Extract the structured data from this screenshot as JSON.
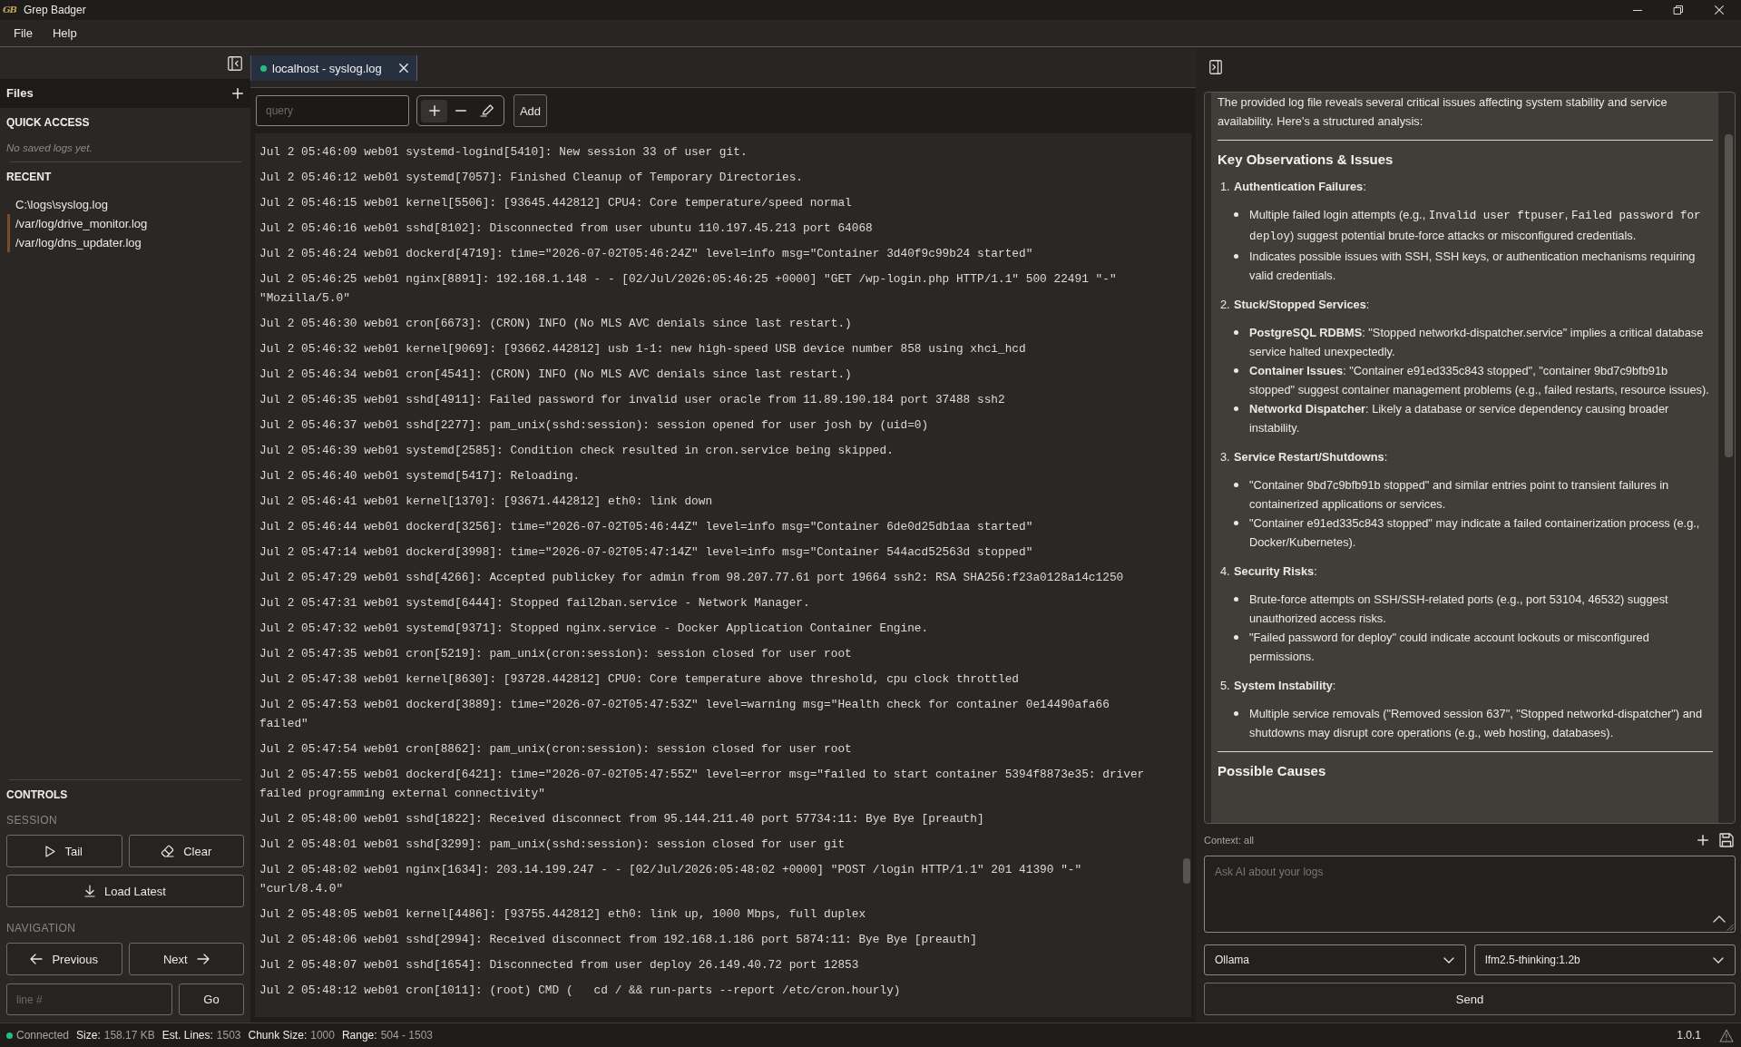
{
  "window": {
    "logo": "GB",
    "title": "Grep Badger"
  },
  "menu": [
    {
      "label": "File"
    },
    {
      "label": "Help"
    }
  ],
  "sidebar": {
    "files_title": "Files",
    "quick_access": {
      "title": "QUICK ACCESS",
      "empty_text": "No saved logs yet."
    },
    "recent": {
      "title": "RECENT",
      "items": [
        {
          "path": "C:\\logs\\syslog.log",
          "remote": false
        },
        {
          "path": "/var/log/drive_monitor.log",
          "remote": true
        },
        {
          "path": "/var/log/dns_updater.log",
          "remote": true
        }
      ]
    },
    "controls": {
      "title": "CONTROLS",
      "session": {
        "title": "SESSION",
        "buttons": [
          {
            "kind": "play",
            "label": "Tail"
          },
          {
            "kind": "eraser",
            "label": "Clear"
          },
          {
            "kind": "download",
            "label": "Load Latest"
          }
        ]
      },
      "navigation": {
        "title": "NAVIGATION",
        "buttons": [
          {
            "kind": "arrow-left",
            "label": "Previous"
          },
          {
            "kind": "arrow-right",
            "label": "Next"
          }
        ],
        "line_input": {
          "placeholder": "line #"
        },
        "go_button": "Go"
      }
    }
  },
  "tabs": [
    {
      "title": "localhost - syslog.log",
      "selected": true,
      "connected": true
    }
  ],
  "toolbar": {
    "query": {
      "placeholder": "query"
    },
    "tools": [
      {
        "kind": "plus",
        "selected": true
      },
      {
        "kind": "minus",
        "selected": false
      },
      {
        "kind": "highlighter",
        "selected": false
      }
    ],
    "add_button": "Add"
  },
  "log": {
    "lines": [
      "Jul 2 05:46:09 web01 systemd-logind[5410]: New session 33 of user git.",
      "Jul 2 05:46:12 web01 systemd[7057]: Finished Cleanup of Temporary Directories.",
      "Jul 2 05:46:15 web01 kernel[5506]: [93645.442812] CPU4: Core temperature/speed normal",
      "Jul 2 05:46:16 web01 sshd[8102]: Disconnected from user ubuntu 110.197.45.213 port 64068",
      "Jul 2 05:46:24 web01 dockerd[4719]: time=\"2026-07-02T05:46:24Z\" level=info msg=\"Container 3d40f9c99b24 started\"",
      "Jul 2 05:46:25 web01 nginx[8891]: 192.168.1.148 - - [02/Jul/2026:05:46:25 +0000] \"GET /wp-login.php HTTP/1.1\" 500 22491 \"-\" \"Mozilla/5.0\"",
      "Jul 2 05:46:30 web01 cron[6673]: (CRON) INFO (No MLS AVC denials since last restart.)",
      "Jul 2 05:46:32 web01 kernel[9069]: [93662.442812] usb 1-1: new high-speed USB device number 858 using xhci_hcd",
      "Jul 2 05:46:34 web01 cron[4541]: (CRON) INFO (No MLS AVC denials since last restart.)",
      "Jul 2 05:46:35 web01 sshd[4911]: Failed password for invalid user oracle from 11.89.190.184 port 37488 ssh2",
      "Jul 2 05:46:37 web01 sshd[2277]: pam_unix(sshd:session): session opened for user josh by (uid=0)",
      "Jul 2 05:46:39 web01 systemd[2585]: Condition check resulted in cron.service being skipped.",
      "Jul 2 05:46:40 web01 systemd[5417]: Reloading.",
      "Jul 2 05:46:41 web01 kernel[1370]: [93671.442812] eth0: link down",
      "Jul 2 05:46:44 web01 dockerd[3256]: time=\"2026-07-02T05:46:44Z\" level=info msg=\"Container 6de0d25db1aa started\"",
      "Jul 2 05:47:14 web01 dockerd[3998]: time=\"2026-07-02T05:47:14Z\" level=info msg=\"Container 544acd52563d stopped\"",
      "Jul 2 05:47:29 web01 sshd[4266]: Accepted publickey for admin from 98.207.77.61 port 19664 ssh2: RSA SHA256:f23a0128a14c1250",
      "Jul 2 05:47:31 web01 systemd[6444]: Stopped fail2ban.service - Network Manager.",
      "Jul 2 05:47:32 web01 systemd[9371]: Stopped nginx.service - Docker Application Container Engine.",
      "Jul 2 05:47:35 web01 cron[5219]: pam_unix(cron:session): session closed for user root",
      "Jul 2 05:47:38 web01 kernel[8630]: [93728.442812] CPU0: Core temperature above threshold, cpu clock throttled",
      "Jul 2 05:47:53 web01 dockerd[3889]: time=\"2026-07-02T05:47:53Z\" level=warning msg=\"Health check for container 0e14490afa66 failed\"",
      "Jul 2 05:47:54 web01 cron[8862]: pam_unix(cron:session): session closed for user root",
      "Jul 2 05:47:55 web01 dockerd[6421]: time=\"2026-07-02T05:47:55Z\" level=error msg=\"failed to start container 5394f8873e35: driver failed programming external connectivity\"",
      "Jul 2 05:48:00 web01 sshd[1822]: Received disconnect from 95.144.211.40 port 57734:11: Bye Bye [preauth]",
      "Jul 2 05:48:01 web01 sshd[3299]: pam_unix(sshd:session): session closed for user git",
      "Jul 2 05:48:02 web01 nginx[1634]: 203.14.199.247 - - [02/Jul/2026:05:48:02 +0000] \"POST /login HTTP/1.1\" 201 41390 \"-\" \"curl/8.4.0\"",
      "Jul 2 05:48:05 web01 kernel[4486]: [93755.442812] eth0: link up, 1000 Mbps, full duplex",
      "Jul 2 05:48:06 web01 sshd[2994]: Received disconnect from 192.168.1.186 port 5874:11: Bye Bye [preauth]",
      "Jul 2 05:48:07 web01 sshd[1654]: Disconnected from user deploy 26.149.40.72 port 12853",
      "Jul 2 05:48:12 web01 cron[1011]: (root) CMD (   cd / && run-parts --report /etc/cron.hourly)"
    ]
  },
  "ai_panel": {
    "response": {
      "intro": "The provided log file reveals several critical issues affecting system stability and service availability. Here's a structured analysis:",
      "sections": [
        {
          "heading": "Key Observations & Issues",
          "items": [
            {
              "number": "1.",
              "title": "**Authentication Failures**:",
              "bullets": [
                {
                  "parts": [
                    {
                      "kind": "text",
                      "text": "Multiple failed login attempts (e.g., "
                    },
                    {
                      "kind": "code",
                      "text": "Invalid user ftpuser"
                    },
                    {
                      "kind": "text",
                      "text": ", "
                    },
                    {
                      "kind": "code",
                      "text": "Failed password for deploy"
                    },
                    {
                      "kind": "text",
                      "text": ") suggest potential brute-force attacks or misconfigured credentials."
                    }
                  ]
                },
                {
                  "parts": [
                    {
                      "kind": "text",
                      "text": "Indicates possible issues with SSH, SSH keys, or authentication mechanisms requiring valid credentials."
                    }
                  ]
                }
              ]
            },
            {
              "number": "2.",
              "title": "**Stuck/Stopped Services**:",
              "bullets": [
                {
                  "parts": [
                    {
                      "kind": "text",
                      "text": "**PostgreSQL RDBMS**: \"Stopped networkd-dispatcher.service\" implies a critical database service halted unexpectedly."
                    }
                  ]
                },
                {
                  "parts": [
                    {
                      "kind": "text",
                      "text": "**Container Issues**: \"Container e91ed335c843 stopped\", \"container 9bd7c9bfb91b stopped\" suggest container management problems (e.g., failed restarts, resource issues)."
                    }
                  ]
                },
                {
                  "parts": [
                    {
                      "kind": "text",
                      "text": "**Networkd Dispatcher**: Likely a database or service dependency causing broader instability."
                    }
                  ]
                }
              ]
            },
            {
              "number": "3.",
              "title": "**Service Restart/Shutdowns**:",
              "bullets": [
                {
                  "parts": [
                    {
                      "kind": "text",
                      "text": "\"Container 9bd7c9bfb91b stopped\" and similar entries point to transient failures in containerized applications or services."
                    }
                  ]
                },
                {
                  "parts": [
                    {
                      "kind": "text",
                      "text": "\"Container e91ed335c843 stopped\" may indicate a failed containerization process (e.g., Docker/Kubernetes)."
                    }
                  ]
                }
              ]
            },
            {
              "number": "4.",
              "title": "**Security Risks**:",
              "bullets": [
                {
                  "parts": [
                    {
                      "kind": "text",
                      "text": "Brute-force attempts on SSH/SSH-related ports (e.g., port 53104, 46532) suggest unauthorized access risks."
                    }
                  ]
                },
                {
                  "parts": [
                    {
                      "kind": "text",
                      "text": "\"Failed password for deploy\" could indicate account lockouts or misconfigured permissions."
                    }
                  ]
                }
              ]
            },
            {
              "number": "5.",
              "title": "**System Instability**:",
              "bullets": [
                {
                  "parts": [
                    {
                      "kind": "text",
                      "text": "Multiple service removals (\"Removed session 637\", \"Stopped networkd-dispatcher\") and shutdowns may disrupt core operations (e.g., web hosting, databases)."
                    }
                  ]
                }
              ]
            }
          ]
        },
        {
          "heading": "Possible Causes"
        }
      ]
    },
    "context_label": "Context: all",
    "prompt": {
      "placeholder": "Ask AI about your logs"
    },
    "provider": {
      "value": "Ollama"
    },
    "model": {
      "value": "lfm2.5-thinking:1.2b"
    },
    "send_button": "Send"
  },
  "status_bar": {
    "connection": {
      "label": "Connected",
      "connected": true
    },
    "stats": [
      {
        "label": "Size:",
        "value": "158.17 KB"
      },
      {
        "label": "Est. Lines:",
        "value": "1503"
      },
      {
        "label": "Chunk Size:",
        "value": "1000"
      },
      {
        "label": "Range:",
        "value": "504 - 1503"
      }
    ],
    "version": "1.0.1"
  }
}
